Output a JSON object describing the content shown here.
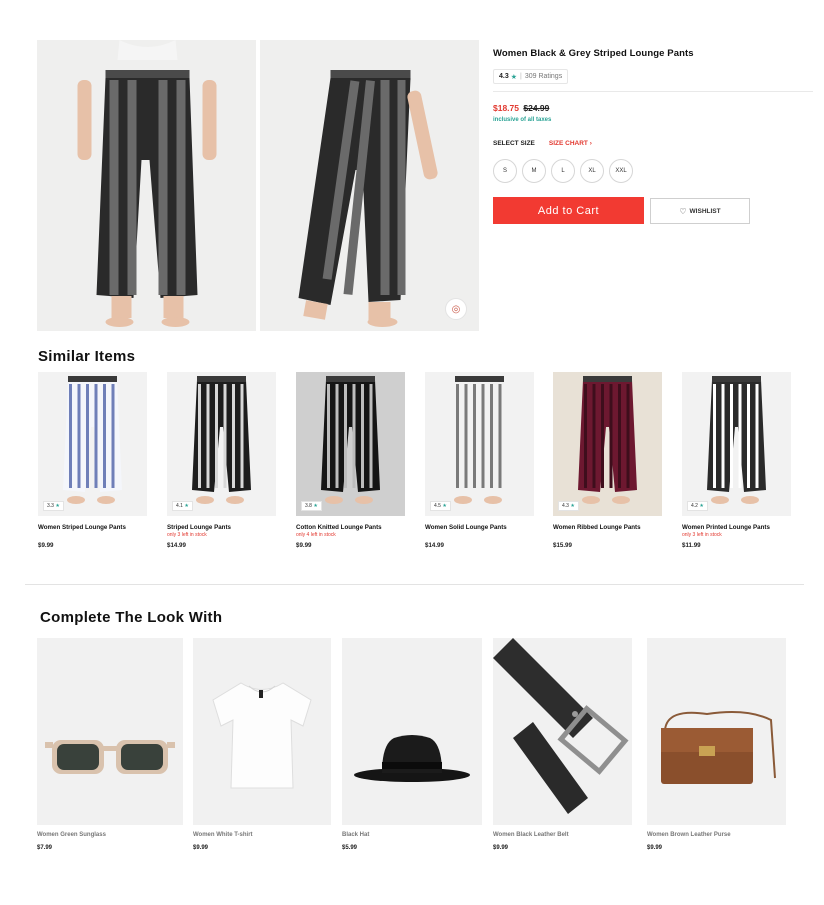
{
  "product": {
    "title": "Women Black & Grey Striped Lounge Pants",
    "rating": "4.3",
    "rating_star": "★",
    "rating_sep": "|",
    "ratings_count": "309 Ratings",
    "price_now": "$18.75",
    "price_was": "$24.99",
    "taxes_note": "inclusive of all taxes",
    "select_size_label": "SELECT SIZE",
    "size_chart_label": "SIZE CHART ›",
    "sizes": [
      "S",
      "M",
      "L",
      "XL",
      "XXL"
    ],
    "add_to_cart_label": "Add to Cart",
    "wishlist_label": "WISHLIST",
    "wishlist_icon": "heart-icon"
  },
  "similar": {
    "title": "Similar Items",
    "items": [
      {
        "name": "Women Striped Lounge Pants",
        "rating": "3.3",
        "stock": "",
        "price": "$9.99",
        "stripe": "#6f7fb8",
        "base": "#f4f6fb"
      },
      {
        "name": "Striped Lounge Pants",
        "rating": "4.1",
        "stock": "only 3 left in stock",
        "price": "$14.99",
        "stripe": "#d8d8d8",
        "base": "#1d1d1d"
      },
      {
        "name": "Cotton Knitted Lounge Pants",
        "rating": "3.8",
        "stock": "only 4 left in stock",
        "price": "$9.99",
        "stripe": "#bdbdbd",
        "base": "#151515"
      },
      {
        "name": "Women Solid Lounge Pants",
        "rating": "4.5",
        "stock": "",
        "price": "$14.99",
        "stripe": "#7a7a7a",
        "base": "#f2f2f2"
      },
      {
        "name": "Women Ribbed Lounge Pants",
        "rating": "4.3",
        "stock": "",
        "price": "$15.99",
        "stripe": "#3e0e1c",
        "base": "#6d1830"
      },
      {
        "name": "Women Printed Lounge Pants",
        "rating": "4.2",
        "stock": "only 3 left in stock",
        "price": "$11.99",
        "stripe": "#ffffff",
        "base": "#2b2b2b"
      }
    ],
    "rating_star": "★"
  },
  "look": {
    "title": "Complete The Look With",
    "items": [
      {
        "name": "Women Green Sunglass",
        "price": "$7.99",
        "icon": "sunglasses-icon"
      },
      {
        "name": "Women White T-shirt",
        "price": "$9.99",
        "icon": "tshirt-icon"
      },
      {
        "name": "Black Hat",
        "price": "$5.99",
        "icon": "hat-icon"
      },
      {
        "name": "Women Black Leather Belt",
        "price": "$9.99",
        "icon": "belt-icon"
      },
      {
        "name": "Women Brown Leather Purse",
        "price": "$9.99",
        "icon": "purse-icon"
      }
    ]
  },
  "viewer_icon": "3d-view-icon"
}
